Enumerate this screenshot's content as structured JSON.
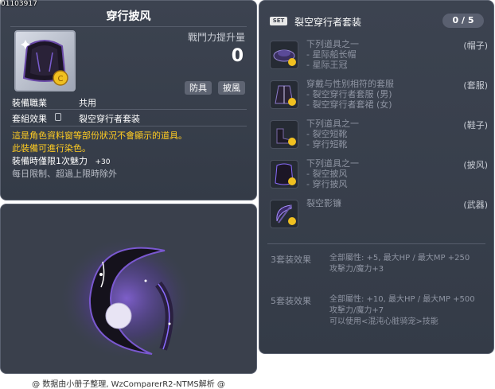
{
  "item_id": "01103917",
  "item": {
    "name": "穿行披风",
    "power_label": "戰鬥力提升量",
    "power_value": "0",
    "tags": [
      "防具",
      "披風"
    ],
    "job_label": "裝備職業",
    "job_value": "共用",
    "set_label": "套組效果",
    "set_value": "裂空穿行者套装",
    "desc_yellow": [
      "這是角色資料窗等部份狀況不會顯示的道具。",
      "此裝備可進行染色。"
    ],
    "charm_label": "裝備時僅限1次魅力",
    "charm_value": "+30",
    "desc_grey": "每日限制、超過上限時除外"
  },
  "set": {
    "badge": "SET",
    "name": "裂空穿行者套装",
    "count": "0 / 5",
    "items": [
      {
        "lines": [
          "下列道具之一",
          "- 星际船长帽",
          "- 星际王冠"
        ],
        "category": "(帽子)",
        "icon": "hat-icon"
      },
      {
        "lines": [
          "穿戴与性别相符的套服",
          "- 裂空穿行者套服 (男)",
          "- 裂空穿行者套裙 (女)"
        ],
        "category": "(套服)",
        "icon": "suit-icon"
      },
      {
        "lines": [
          "下列道具之一",
          "- 裂空短靴",
          "- 穿行短靴"
        ],
        "category": "(鞋子)",
        "icon": "shoes-icon"
      },
      {
        "lines": [
          "下列道具之一",
          "- 裂空披风",
          "- 穿行披风"
        ],
        "category": "(披风)",
        "icon": "cape-icon"
      },
      {
        "lines": [
          "裂空影镰"
        ],
        "category": "(武器)",
        "icon": "scythe-icon"
      }
    ],
    "bonuses": [
      {
        "label": "3套装效果",
        "lines": [
          "全部屬性: +5, 最大HP / 最大MP +250",
          "攻擊力/魔力+3"
        ]
      },
      {
        "label": "5套装效果",
        "lines": [
          "全部屬性: +10, 最大HP / 最大MP +500",
          "攻擊力/魔力+7",
          "可以使用<混沌心脏骑宠>技能"
        ]
      }
    ]
  },
  "footer": "@ 数据由小册子整理, WzComparerR2-NTMS解析 @",
  "colors": {
    "panel": "#3a404c",
    "yellow_text": "#ffcc22",
    "grey_text": "#8e94a2",
    "accent_purple": "#8a5cff"
  }
}
